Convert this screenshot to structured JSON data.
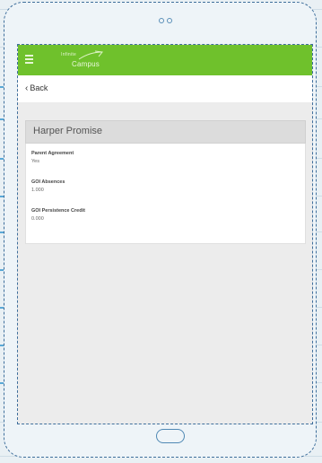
{
  "app": {
    "logo_line1": "Infinite",
    "logo_line2": "Campus"
  },
  "navigation": {
    "back_label": "Back"
  },
  "section": {
    "title": "Harper Promise"
  },
  "fields": [
    {
      "label": "Parent Agreement",
      "value": "Yes"
    },
    {
      "label": "GOI Absences",
      "value": "1.000"
    },
    {
      "label": "GOI Persistence Credit",
      "value": "0.000"
    }
  ],
  "colors": {
    "appbar": "#6fc12c",
    "frame_outline": "#3f6f9c",
    "screen_background": "#ececec"
  },
  "icons": {
    "menu": "menu-icon",
    "back": "chevron-left-icon",
    "home": "home-button-icon"
  }
}
